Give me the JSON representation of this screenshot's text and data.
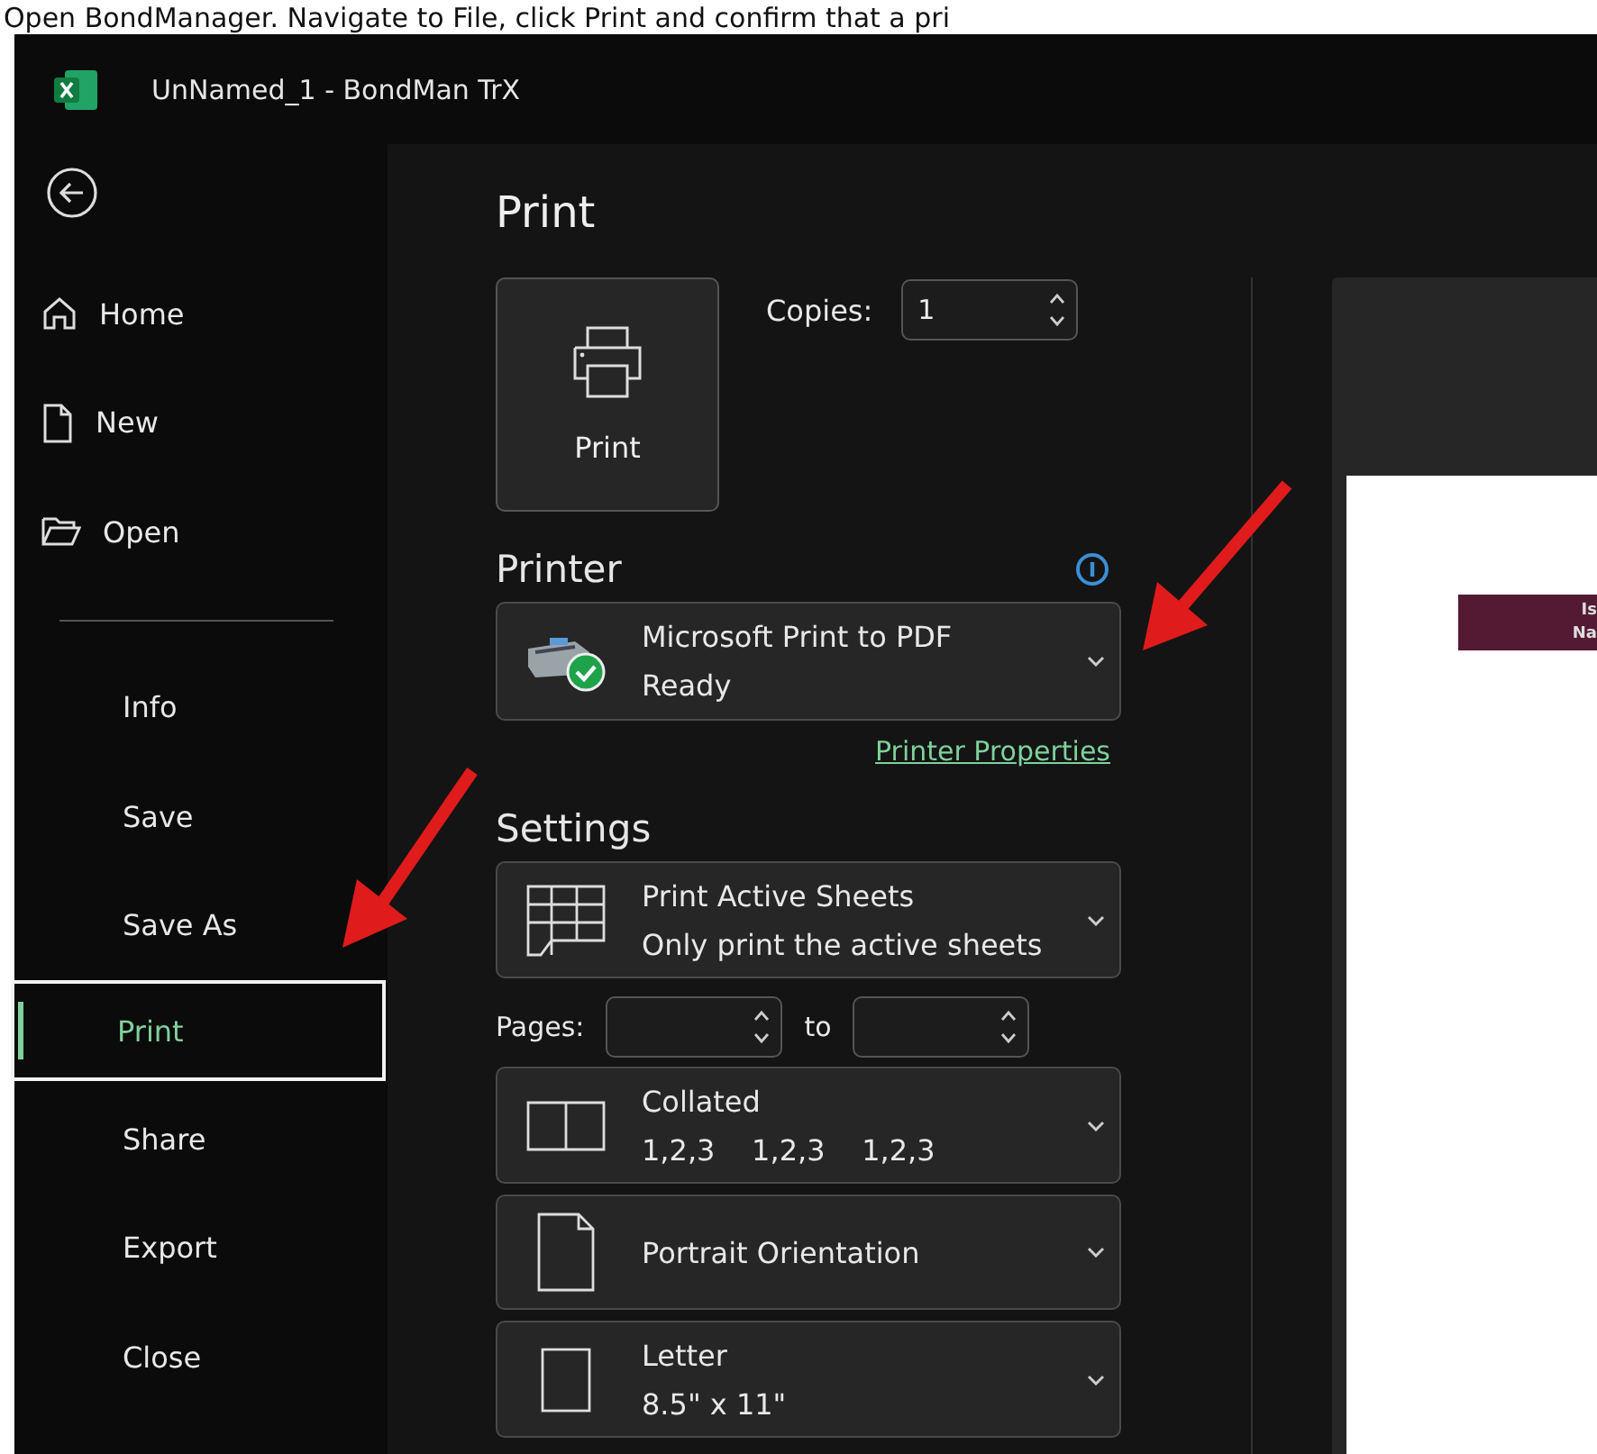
{
  "instruction": "Open BondManager. Navigate to File, click Print and confirm that a pri",
  "window": {
    "title": "UnNamed_1  -  BondMan TrX"
  },
  "sidebar": {
    "items": [
      {
        "label": "Home",
        "kind": "home",
        "selected": false
      },
      {
        "label": "New",
        "kind": "new",
        "selected": false
      },
      {
        "label": "Open",
        "kind": "open",
        "selected": false
      },
      {
        "label": "Info",
        "selected": false
      },
      {
        "label": "Save",
        "selected": false
      },
      {
        "label": "Save As",
        "selected": false
      },
      {
        "label": "Print",
        "selected": true
      },
      {
        "label": "Share",
        "selected": false
      },
      {
        "label": "Export",
        "selected": false
      },
      {
        "label": "Close",
        "selected": false
      }
    ]
  },
  "print": {
    "heading": "Print",
    "button": "Print",
    "copies_label": "Copies:",
    "copies": "1"
  },
  "printer": {
    "heading": "Printer",
    "name": "Microsoft Print to PDF",
    "status": "Ready",
    "properties_link": "Printer Properties"
  },
  "settings": {
    "heading": "Settings",
    "pages_label": "Pages:",
    "to_label": "to",
    "options": [
      {
        "kind": "sheets",
        "title": "Print Active Sheets",
        "subtitle": "Only print the active sheets"
      },
      {
        "kind": "pages"
      },
      {
        "kind": "collated",
        "title": "Collated",
        "subtitle": "1,2,3    1,2,3    1,2,3"
      },
      {
        "kind": "orientation",
        "title": "Portrait Orientation"
      },
      {
        "kind": "paper",
        "title": "Letter",
        "subtitle": "8.5\" x 11\""
      }
    ]
  },
  "preview": {
    "header_lines": [
      "Is",
      "Na"
    ]
  }
}
